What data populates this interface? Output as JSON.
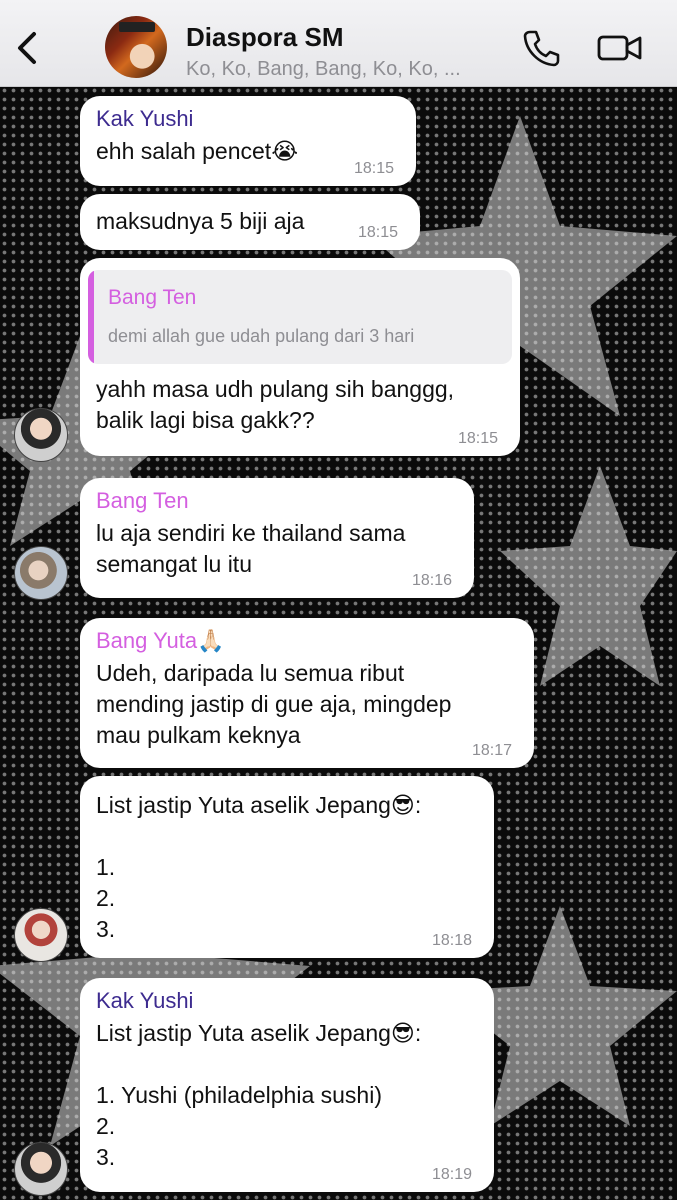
{
  "header": {
    "title": "Diaspora SM",
    "subtitle": "Ko, Ko, Bang, Bang, Ko, Ko, ..."
  },
  "colors": {
    "kak_yushi": "#3d2b8f",
    "bang_ten": "#d45fe0",
    "bang_yuta": "#d45fe0"
  },
  "messages": [
    {
      "sender": "Kak Yushi",
      "text": "ehh salah pencet😭",
      "time": "18:15"
    },
    {
      "text": "maksudnya 5 biji aja",
      "time": "18:15"
    },
    {
      "reply_to": {
        "sender": "Bang Ten",
        "text": "demi allah gue udah pulang dari 3 hari"
      },
      "text": "yahh masa udh pulang sih banggg,\nbalik lagi bisa gakk??",
      "time": "18:15"
    },
    {
      "sender": "Bang Ten",
      "text": "lu aja sendiri ke thailand sama\nsemangat lu itu",
      "time": "18:16"
    },
    {
      "sender": "Bang Yuta🙏🏻",
      "text": "Udeh, daripada lu semua ribut\nmending jastip di gue aja, mingdep\nmau pulkam keknya",
      "time": "18:17"
    },
    {
      "text": "List jastip Yuta aselik Jepang😎:\n\n1.\n2.\n3.",
      "time": "18:18"
    },
    {
      "sender": "Kak Yushi",
      "text": "List jastip Yuta aselik Jepang😎:\n\n1. Yushi (philadelphia sushi)\n2.\n3.",
      "time": "18:19"
    }
  ]
}
